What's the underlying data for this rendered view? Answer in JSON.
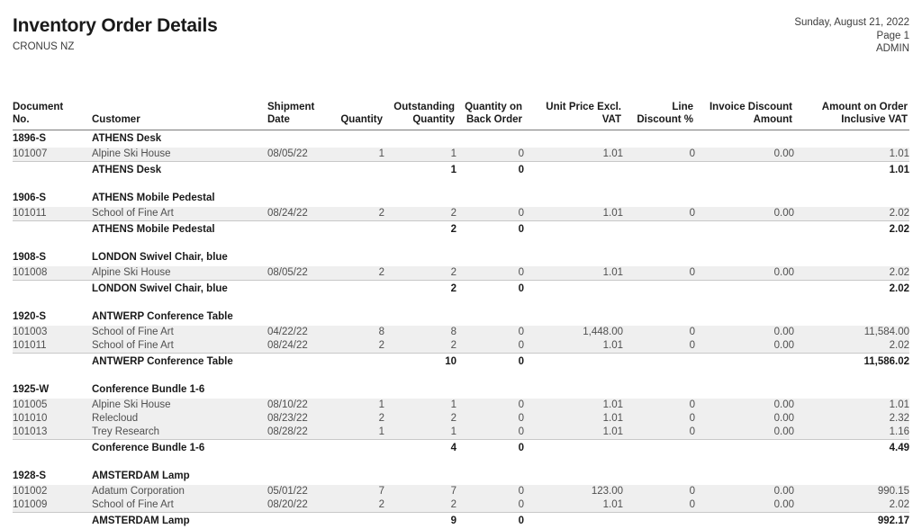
{
  "header": {
    "title": "Inventory Order Details",
    "company": "CRONUS NZ",
    "date": "Sunday, August 21, 2022",
    "page": "Page 1",
    "user": "ADMIN"
  },
  "columns": [
    {
      "line1": "Document",
      "line2": "No.",
      "align": "left"
    },
    {
      "line1": "",
      "line2": "Customer",
      "align": "left"
    },
    {
      "line1": "Shipment",
      "line2": "Date",
      "align": "left"
    },
    {
      "line1": "",
      "line2": "Quantity",
      "align": "right"
    },
    {
      "line1": "Outstanding",
      "line2": "Quantity",
      "align": "right"
    },
    {
      "line1": "Quantity on",
      "line2": "Back Order",
      "align": "right"
    },
    {
      "line1": "",
      "line2": "Unit Price Excl. VAT",
      "align": "right"
    },
    {
      "line1": "Line",
      "line2": "Discount %",
      "align": "right"
    },
    {
      "line1": "Invoice Discount",
      "line2": "Amount",
      "align": "right"
    },
    {
      "line1": "Amount on Order",
      "line2": "Inclusive VAT",
      "align": "right"
    }
  ],
  "groups": [
    {
      "item_no": "1896-S",
      "item_name": "ATHENS Desk",
      "lines": [
        {
          "doc_no": "101007",
          "customer": "Alpine Ski House",
          "shipment_date": "08/05/22",
          "quantity": "1",
          "outstanding_quantity": "1",
          "back_order": "0",
          "unit_price": "1.01",
          "line_discount": "0",
          "invoice_discount": "0.00",
          "amount": "1.01"
        }
      ],
      "total": {
        "label": "ATHENS Desk",
        "outstanding_quantity": "1",
        "back_order": "0",
        "amount": "1.01"
      }
    },
    {
      "item_no": "1906-S",
      "item_name": "ATHENS Mobile Pedestal",
      "lines": [
        {
          "doc_no": "101011",
          "customer": "School of Fine Art",
          "shipment_date": "08/24/22",
          "quantity": "2",
          "outstanding_quantity": "2",
          "back_order": "0",
          "unit_price": "1.01",
          "line_discount": "0",
          "invoice_discount": "0.00",
          "amount": "2.02"
        }
      ],
      "total": {
        "label": "ATHENS Mobile Pedestal",
        "outstanding_quantity": "2",
        "back_order": "0",
        "amount": "2.02"
      }
    },
    {
      "item_no": "1908-S",
      "item_name": "LONDON Swivel Chair, blue",
      "lines": [
        {
          "doc_no": "101008",
          "customer": "Alpine Ski House",
          "shipment_date": "08/05/22",
          "quantity": "2",
          "outstanding_quantity": "2",
          "back_order": "0",
          "unit_price": "1.01",
          "line_discount": "0",
          "invoice_discount": "0.00",
          "amount": "2.02"
        }
      ],
      "total": {
        "label": "LONDON Swivel Chair, blue",
        "outstanding_quantity": "2",
        "back_order": "0",
        "amount": "2.02"
      }
    },
    {
      "item_no": "1920-S",
      "item_name": "ANTWERP Conference Table",
      "lines": [
        {
          "doc_no": "101003",
          "customer": "School of Fine Art",
          "shipment_date": "04/22/22",
          "quantity": "8",
          "outstanding_quantity": "8",
          "back_order": "0",
          "unit_price": "1,448.00",
          "line_discount": "0",
          "invoice_discount": "0.00",
          "amount": "11,584.00"
        },
        {
          "doc_no": "101011",
          "customer": "School of Fine Art",
          "shipment_date": "08/24/22",
          "quantity": "2",
          "outstanding_quantity": "2",
          "back_order": "0",
          "unit_price": "1.01",
          "line_discount": "0",
          "invoice_discount": "0.00",
          "amount": "2.02"
        }
      ],
      "total": {
        "label": "ANTWERP Conference Table",
        "outstanding_quantity": "10",
        "back_order": "0",
        "amount": "11,586.02"
      }
    },
    {
      "item_no": "1925-W",
      "item_name": "Conference Bundle 1-6",
      "lines": [
        {
          "doc_no": "101005",
          "customer": "Alpine Ski House",
          "shipment_date": "08/10/22",
          "quantity": "1",
          "outstanding_quantity": "1",
          "back_order": "0",
          "unit_price": "1.01",
          "line_discount": "0",
          "invoice_discount": "0.00",
          "amount": "1.01"
        },
        {
          "doc_no": "101010",
          "customer": "Relecloud",
          "shipment_date": "08/23/22",
          "quantity": "2",
          "outstanding_quantity": "2",
          "back_order": "0",
          "unit_price": "1.01",
          "line_discount": "0",
          "invoice_discount": "0.00",
          "amount": "2.32"
        },
        {
          "doc_no": "101013",
          "customer": "Trey Research",
          "shipment_date": "08/28/22",
          "quantity": "1",
          "outstanding_quantity": "1",
          "back_order": "0",
          "unit_price": "1.01",
          "line_discount": "0",
          "invoice_discount": "0.00",
          "amount": "1.16"
        }
      ],
      "total": {
        "label": "Conference Bundle 1-6",
        "outstanding_quantity": "4",
        "back_order": "0",
        "amount": "4.49"
      }
    },
    {
      "item_no": "1928-S",
      "item_name": "AMSTERDAM Lamp",
      "lines": [
        {
          "doc_no": "101002",
          "customer": "Adatum Corporation",
          "shipment_date": "05/01/22",
          "quantity": "7",
          "outstanding_quantity": "7",
          "back_order": "0",
          "unit_price": "123.00",
          "line_discount": "0",
          "invoice_discount": "0.00",
          "amount": "990.15"
        },
        {
          "doc_no": "101009",
          "customer": "School of Fine Art",
          "shipment_date": "08/20/22",
          "quantity": "2",
          "outstanding_quantity": "2",
          "back_order": "0",
          "unit_price": "1.01",
          "line_discount": "0",
          "invoice_discount": "0.00",
          "amount": "2.02"
        }
      ],
      "total": {
        "label": "AMSTERDAM Lamp",
        "outstanding_quantity": "9",
        "back_order": "0",
        "amount": "992.17"
      }
    }
  ]
}
